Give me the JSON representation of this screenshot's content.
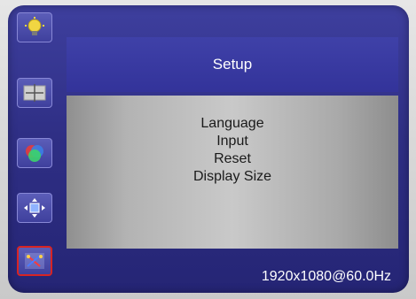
{
  "osd": {
    "title": "Setup",
    "menu_items": [
      {
        "label": "Language"
      },
      {
        "label": "Input"
      },
      {
        "label": "Reset"
      },
      {
        "label": "Display Size"
      }
    ],
    "resolution": "1920x1080@60.0Hz"
  },
  "sidebar": {
    "icons": [
      {
        "name": "brightness-icon",
        "selected": false
      },
      {
        "name": "image-position-icon",
        "selected": false
      },
      {
        "name": "color-icon",
        "selected": false
      },
      {
        "name": "position-icon",
        "selected": false
      },
      {
        "name": "setup-tools-icon",
        "selected": true
      }
    ]
  },
  "colors": {
    "screen_blue": "#2f2f85",
    "header_blue": "#3f41a8",
    "panel_gray": "#c9c9c9",
    "selected_border": "#d72424"
  }
}
